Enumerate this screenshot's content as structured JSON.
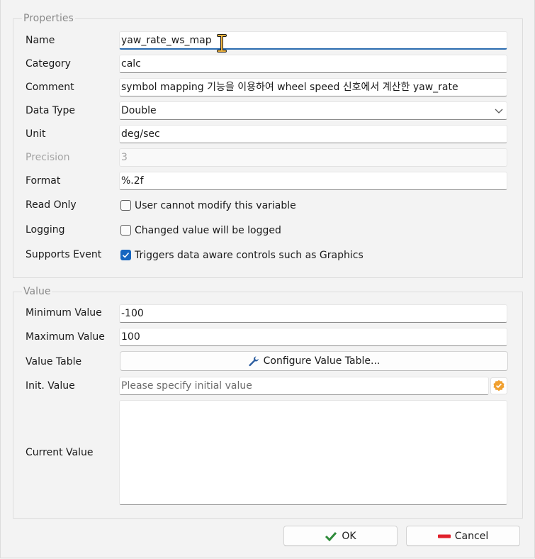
{
  "properties": {
    "title": "Properties",
    "name": {
      "label": "Name",
      "value": "yaw_rate_ws_map"
    },
    "category": {
      "label": "Category",
      "value": "calc"
    },
    "comment": {
      "label": "Comment",
      "value": "symbol mapping 기능을 이용하여 wheel speed 신호에서 계산한 yaw_rate"
    },
    "data_type": {
      "label": "Data Type",
      "value": "Double"
    },
    "unit": {
      "label": "Unit",
      "value": "deg/sec"
    },
    "precision": {
      "label": "Precision",
      "value": "3"
    },
    "format": {
      "label": "Format",
      "value": "%.2f"
    },
    "read_only": {
      "label": "Read Only",
      "checkbox_label": "User cannot modify this variable",
      "checked": false
    },
    "logging": {
      "label": "Logging",
      "checkbox_label": "Changed value will be logged",
      "checked": false
    },
    "supports_event": {
      "label": "Supports Event",
      "checkbox_label": "Triggers data aware controls such as Graphics",
      "checked": true
    }
  },
  "value": {
    "title": "Value",
    "minimum": {
      "label": "Minimum Value",
      "value": "-100"
    },
    "maximum": {
      "label": "Maximum Value",
      "value": "100"
    },
    "value_table": {
      "label": "Value Table",
      "button_label": "Configure Value Table..."
    },
    "init": {
      "label": "Init. Value",
      "placeholder": "Please specify initial value"
    },
    "current": {
      "label": "Current Value",
      "value": ""
    }
  },
  "footer": {
    "ok_label": "OK",
    "cancel_label": "Cancel"
  },
  "colors": {
    "accent": "#1565c0",
    "ok_green": "#2e8b3a",
    "cancel_red": "#e0212b",
    "badge_orange": "#f0a030"
  },
  "icons": {
    "value_table": "wrench-icon",
    "init_badge": "verified-badge-icon",
    "ok": "checkmark-icon",
    "cancel": "minus-icon",
    "data_type": "chevron-down-icon"
  }
}
